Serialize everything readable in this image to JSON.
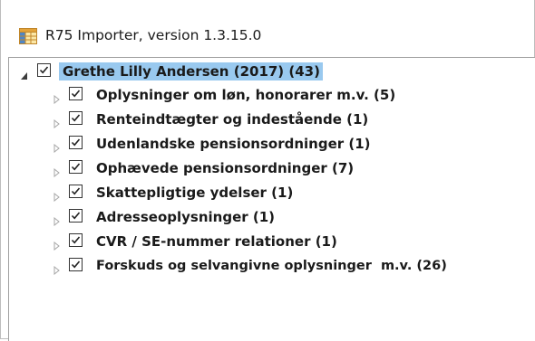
{
  "window": {
    "title": "R75 Importer, version 1.3.15.0",
    "icon": "table-app-icon"
  },
  "tree": {
    "root": {
      "label": "Grethe Lilly Andersen (2017) (43)",
      "checked": true,
      "expanded": true,
      "selected": true
    },
    "children": [
      {
        "label": "Oplysninger om løn, honorarer m.v. (5)",
        "checked": true,
        "expanded": false
      },
      {
        "label": "Renteindtægter og indestående (1)",
        "checked": true,
        "expanded": false
      },
      {
        "label": "Udenlandske pensionsordninger (1)",
        "checked": true,
        "expanded": false
      },
      {
        "label": "Ophævede pensionsordninger (7)",
        "checked": true,
        "expanded": false
      },
      {
        "label": "Skattepligtige ydelser (1)",
        "checked": true,
        "expanded": false
      },
      {
        "label": "Adresseoplysninger (1)",
        "checked": true,
        "expanded": false
      },
      {
        "label": "CVR / SE-nummer relationer (1)",
        "checked": true,
        "expanded": false
      },
      {
        "label": "Forskuds og selvangivne oplysninger  m.v. (26)",
        "checked": true,
        "expanded": false
      }
    ]
  },
  "colors": {
    "selection": "#99c9ef",
    "text": "#1a1a1a"
  }
}
